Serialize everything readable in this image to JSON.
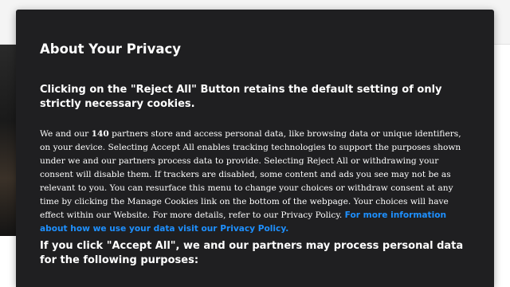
{
  "dialog": {
    "title": "About Your Privacy",
    "reject_heading": "Clicking on the \"Reject All\" Button retains the default setting of only strictly necessary cookies.",
    "body_part1": "We and our ",
    "partner_count": "140",
    "body_part2": " partners store and access personal data, like browsing data or unique identifiers, on your device. Selecting Accept All enables tracking technologies to support the purposes shown under we and our partners process data to provide. Selecting Reject All or withdrawing your consent will disable them. If trackers are disabled, some content and ads you see may not be as relevant to you. You can resurface this menu to change your choices or withdraw consent at any time by clicking the Manage Cookies link on the bottom of the webpage. Your choices will have effect within our Website. For more details, refer to our Privacy Policy. ",
    "policy_link_text": "For more information about how we use your data visit our Privacy Policy.",
    "accept_heading": "If you click \"Accept All\", we and our partners may process personal data for the following purposes:"
  },
  "colors": {
    "dialog_background": "#1f1f21",
    "text": "#ffffff",
    "link": "#1e90ff"
  }
}
